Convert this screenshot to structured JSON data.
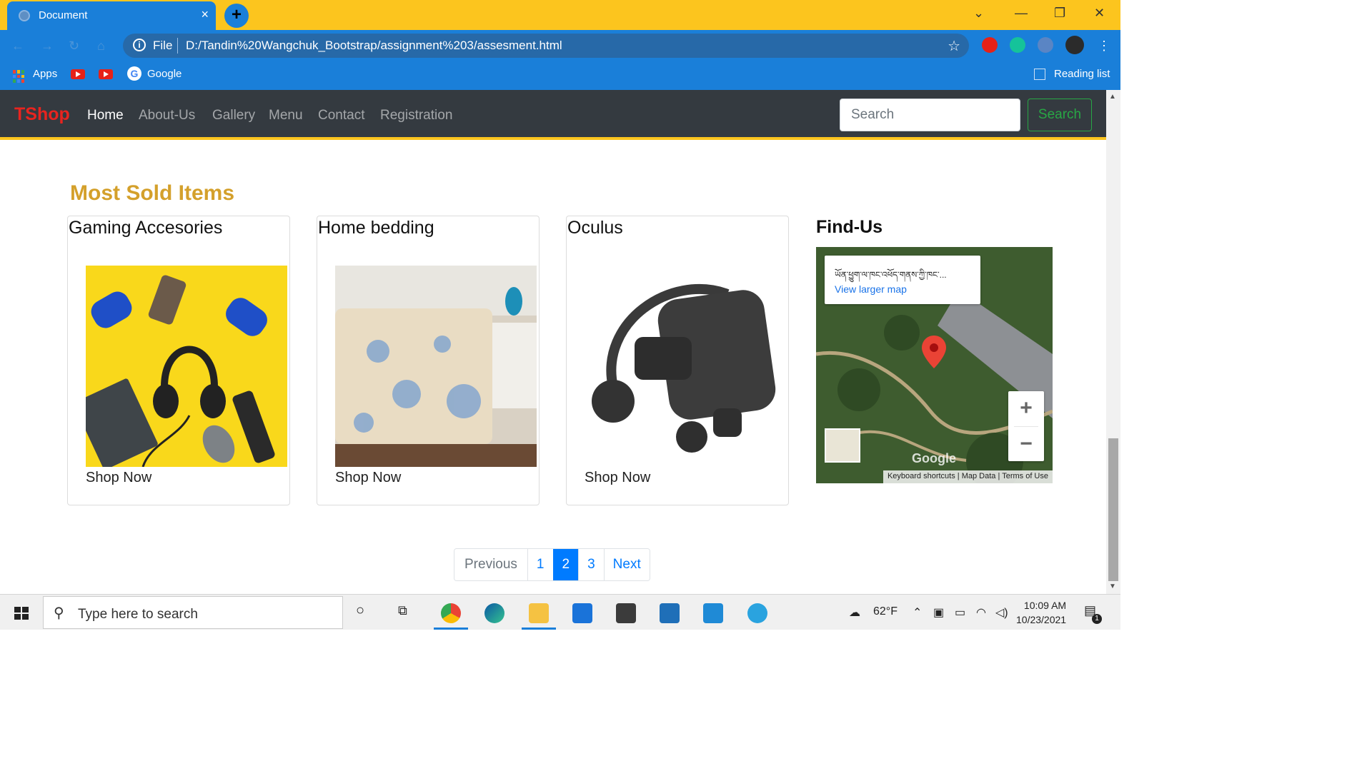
{
  "browser": {
    "tab_title": "Document",
    "tab_close": "×",
    "new_tab": "+",
    "address_scheme": "File",
    "address_url": "D:/Tandin%20Wangchuk_Bootstrap/assignment%203/assesment.html",
    "bookmarks": [
      {
        "label": "Apps",
        "icon": "apps-grid-icon"
      },
      {
        "label": "",
        "icon": "youtube-icon"
      },
      {
        "label": "",
        "icon": "youtube-icon"
      },
      {
        "label": "Google",
        "icon": "google-icon"
      }
    ],
    "reading_list": "Reading list"
  },
  "site": {
    "brand": "TShop",
    "nav": [
      {
        "label": "Home",
        "active": true
      },
      {
        "label": "About-Us",
        "active": false
      },
      {
        "label": "Gallery",
        "active": false
      },
      {
        "label": "Menu",
        "active": false
      },
      {
        "label": "Contact",
        "active": false
      },
      {
        "label": "Registration",
        "active": false
      }
    ],
    "search_placeholder": "Search",
    "search_button": "Search",
    "brand_color": "#e8241f",
    "accent_color": "#fcc51e"
  },
  "section": {
    "title": "Most Sold Items",
    "cards": [
      {
        "title": "Gaming Accesories",
        "link": "Shop Now",
        "image": "gaming-accessories-image"
      },
      {
        "title": "Home bedding",
        "link": "Shop Now",
        "image": "home-bedding-image"
      },
      {
        "title": "Oculus",
        "link": "Shop Now",
        "image": "oculus-headset-image"
      }
    ]
  },
  "findus": {
    "title": "Find-Us",
    "place_name": "ཡོན་ཕྱུག་ལ་ཁང་འཕོད་གནས་ཀྱི་ཁང་...",
    "view_larger": "View larger map",
    "zoom_in": "+",
    "zoom_out": "−",
    "google_logo": "Google",
    "attribution": [
      "Keyboard shortcuts",
      "Map Data",
      "Terms of Use"
    ]
  },
  "pagination": {
    "previous": "Previous",
    "pages": [
      "1",
      "2",
      "3"
    ],
    "active_page": "2",
    "next": "Next"
  },
  "taskbar": {
    "search_placeholder": "Type here to search",
    "weather": "62°F",
    "time": "10:09 AM",
    "date": "10/23/2021",
    "notifications": "1"
  }
}
